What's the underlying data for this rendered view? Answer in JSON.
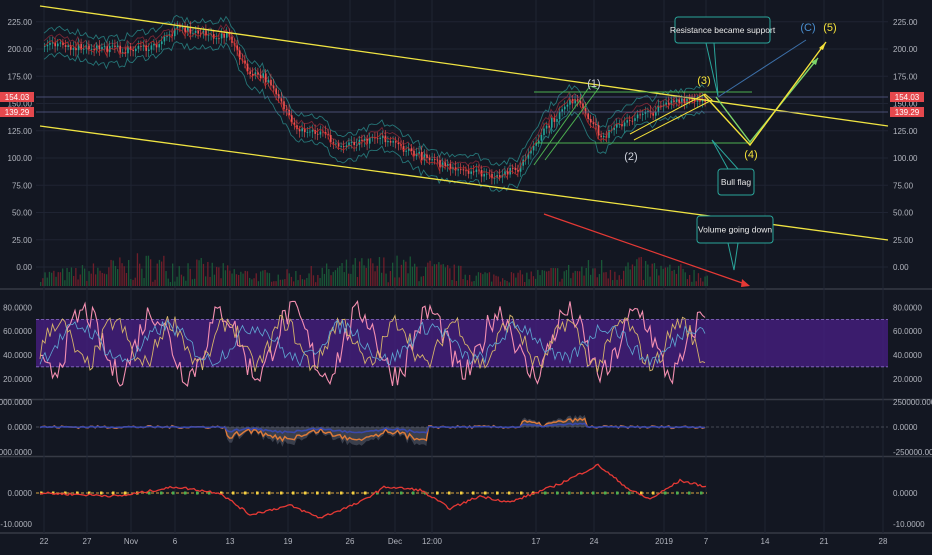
{
  "colors": {
    "background": "#131722",
    "grid": "#1f2433",
    "separator": "#363a45",
    "trendline": "#f0e442",
    "wave": "#4caf50",
    "projection_yellow": "#f5e23a",
    "projection_green": "#7bd36a",
    "callout_border": "#2aa59a",
    "volume_arrow": "#e53935",
    "rsi_band": "#4a1f87",
    "price_tag": "#e5484d",
    "candle_up": "#26a69a",
    "candle_down": "#ef5350"
  },
  "chart_data": [
    {
      "type": "candlestick",
      "panel": "price",
      "y_ticks": [
        "225.00",
        "200.00",
        "175.00",
        "150.00",
        "125.00",
        "100.00",
        "75.00",
        "50.00",
        "25.00",
        "0.00"
      ],
      "ylim": [
        -10,
        235
      ],
      "price_tags": [
        "154.03",
        "139.29"
      ],
      "price_path": [
        {
          "x": "Oct 22",
          "y": 203
        },
        {
          "x": "Oct 27",
          "y": 202
        },
        {
          "x": "Nov 1",
          "y": 199
        },
        {
          "x": "Nov 4",
          "y": 203
        },
        {
          "x": "Nov 7",
          "y": 219
        },
        {
          "x": "Nov 10",
          "y": 213
        },
        {
          "x": "Nov 13",
          "y": 211
        },
        {
          "x": "Nov 15",
          "y": 180
        },
        {
          "x": "Nov 17",
          "y": 175
        },
        {
          "x": "Nov 19",
          "y": 150
        },
        {
          "x": "Nov 21",
          "y": 128
        },
        {
          "x": "Nov 24",
          "y": 122
        },
        {
          "x": "Nov 26",
          "y": 110
        },
        {
          "x": "Nov 28",
          "y": 113
        },
        {
          "x": "Dec 1",
          "y": 118
        },
        {
          "x": "Dec 5",
          "y": 104
        },
        {
          "x": "Dec 7",
          "y": 96
        },
        {
          "x": "Dec 10",
          "y": 91
        },
        {
          "x": "Dec 14",
          "y": 84
        },
        {
          "x": "Dec 17",
          "y": 89
        },
        {
          "x": "Dec 20",
          "y": 125
        },
        {
          "x": "Dec 24",
          "y": 157
        },
        {
          "x": "Dec 27",
          "y": 118
        },
        {
          "x": "Dec 30",
          "y": 135
        },
        {
          "x": "Jan 2",
          "y": 142
        },
        {
          "x": "Jan 5",
          "y": 154
        }
      ],
      "annotations": {
        "callout_resistance": "Resistance became support",
        "callout_bull_flag": "Bull flag",
        "callout_volume": "Volume going down",
        "wave_1": "(1)",
        "wave_2": "(2)",
        "wave_3": "(3)",
        "wave_4": "(4)",
        "wave_5": "(5)",
        "wave_c": "(C)"
      }
    },
    {
      "type": "line",
      "panel": "oscillator",
      "y_ticks": [
        "80.0000",
        "60.0000",
        "40.0000",
        "20.0000"
      ],
      "ylim": [
        10,
        90
      ],
      "band": [
        30,
        70
      ]
    },
    {
      "type": "area",
      "panel": "volume-flow",
      "y_ticks": [
        "250000.0000",
        "0.0000",
        "-250000.0000"
      ],
      "ylim": [
        -380000,
        380000
      ]
    },
    {
      "type": "line",
      "panel": "momentum",
      "y_ticks": [
        "0.0000",
        "-10.0000"
      ],
      "ylim": [
        -12,
        8
      ]
    },
    {
      "type": "axis",
      "x_tick_labels": [
        "22",
        "27",
        "Nov",
        "6",
        "13",
        "19",
        "26",
        "Dec",
        "12:00",
        "17",
        "24",
        "2019",
        "7",
        "14",
        "21",
        "28"
      ]
    }
  ]
}
